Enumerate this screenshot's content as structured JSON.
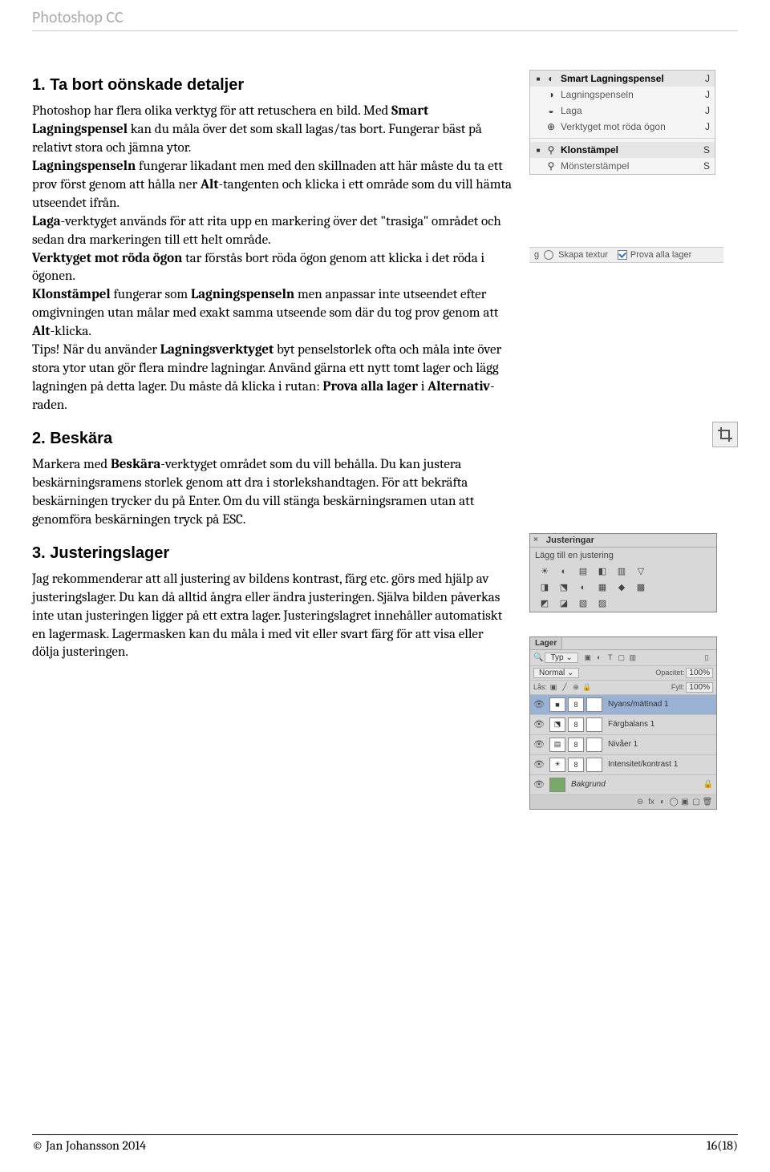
{
  "header": "Photoshop CC",
  "section1": {
    "title": "1. Ta bort oönskade detaljer",
    "p1a": "Photoshop har flera olika verktyg för att retuschera en bild. Med ",
    "p1b": "Smart Lagningspensel",
    "p1c": " kan du måla över det som skall lagas/tas bort. Fungerar bäst på relativt stora och jämna ytor.",
    "p2a": "Lagningspenseln",
    "p2b": " fungerar likadant men med den skillnaden att här måste du ta ett prov först genom att hålla ner ",
    "p2c": "Alt",
    "p2d": "-tangenten och klicka i ett område som du vill hämta utseendet ifrån.",
    "p3a": "Laga",
    "p3b": "-verktyget används för att rita upp en markering över det \"trasiga\" området och sedan dra markeringen till ett helt område.",
    "p4a": "Verktyget mot röda ögon",
    "p4b": " tar förstås bort röda ögon genom att klicka i det röda i ögonen.",
    "p5a": "Klonstämpel",
    "p5b": " fungerar som ",
    "p5c": "Lagningspenseln",
    "p5d": " men anpassar inte utseendet efter omgivningen utan målar med exakt samma utseende som där du tog prov genom att ",
    "p5e": "Alt",
    "p5f": "-klicka.",
    "p6a": "Tips! När du använder ",
    "p6b": "Lagningsverktyget",
    "p6c": " byt penselstorlek ofta och måla inte över stora ytor utan gör flera mindre lagningar. Använd gärna ett nytt tomt lager och lägg lagningen på detta lager. Du måste då klicka i rutan: ",
    "p6d": "Prova alla lager",
    "p6e": " i ",
    "p6f": "Alternativ",
    "p6g": "-raden."
  },
  "section2": {
    "title": "2. Beskära",
    "p1a": "Markera med ",
    "p1b": "Beskära",
    "p1c": "-verktyget området som du vill behålla. Du kan justera beskärningsramens storlek genom att dra i storlekshandtagen. För att bekräfta beskärningen trycker du på Enter. Om du vill stänga beskärningsramen utan att genomföra beskärningen tryck på ESC."
  },
  "section3": {
    "title": "3. Justeringslager",
    "p1": "Jag rekommenderar att all justering av bildens kontrast, färg etc. görs med hjälp av justeringslager. Du kan då alltid ångra eller ändra justeringen. Själva bilden påverkas inte utan justeringen ligger på ett extra lager. Justeringslagret innehåller automatiskt en lagermask. Lagermasken kan du måla i med vit eller svart färg för att visa eller dölja justeringen."
  },
  "tools": [
    {
      "label": "Smart Lagningspensel",
      "key": "J",
      "sel": true,
      "icon": "◐"
    },
    {
      "label": "Lagningspenseln",
      "key": "J",
      "sel": false,
      "icon": "◑"
    },
    {
      "label": "Laga",
      "key": "J",
      "sel": false,
      "icon": "◒"
    },
    {
      "label": "Verktyget mot röda ögon",
      "key": "J",
      "sel": false,
      "icon": "⊕"
    }
  ],
  "tools2": [
    {
      "label": "Klonstämpel",
      "key": "S",
      "sel": true,
      "icon": "⚲"
    },
    {
      "label": "Mönsterstämpel",
      "key": "S",
      "sel": false,
      "icon": "⚲"
    }
  ],
  "optbar": {
    "before": "g",
    "radio": "Skapa textur",
    "check": "Prova alla lager"
  },
  "adjustments": {
    "tab": "Justeringar",
    "sub": "Lägg till en justering",
    "row1": [
      "☀",
      "◐",
      "▤",
      "◧",
      "▥",
      "▽"
    ],
    "row2": [
      "◨",
      "⬔",
      "◐",
      "▦",
      "◆",
      "▩"
    ],
    "row3": [
      "◩",
      "◪",
      "▧",
      "▨"
    ]
  },
  "layers": {
    "tab": "Lager",
    "typ": "Typ",
    "filter_icons": [
      "▣",
      "◐",
      "T",
      "▢",
      "▥"
    ],
    "blend": "Normal",
    "opacity_label": "Opacitet:",
    "opacity": "100%",
    "lock_label": "Lås:",
    "lock_icons": [
      "▣",
      "╱",
      "⊕",
      "🔒"
    ],
    "fill_label": "Fyll:",
    "fill": "100%",
    "rows": [
      {
        "name": "Nyans/mättnad 1",
        "active": true
      },
      {
        "name": "Färgbalans 1",
        "active": false
      },
      {
        "name": "Nivåer 1",
        "active": false
      },
      {
        "name": "Intensitet/kontrast 1",
        "active": false
      },
      {
        "name": "Bakgrund",
        "active": false,
        "bg": true
      }
    ],
    "footer": [
      "⊖",
      "fx",
      "◐",
      "◯",
      "▣",
      "▢",
      "🗑"
    ]
  },
  "footer": {
    "left": "© Jan Johansson 2014",
    "right": "16(18)"
  }
}
